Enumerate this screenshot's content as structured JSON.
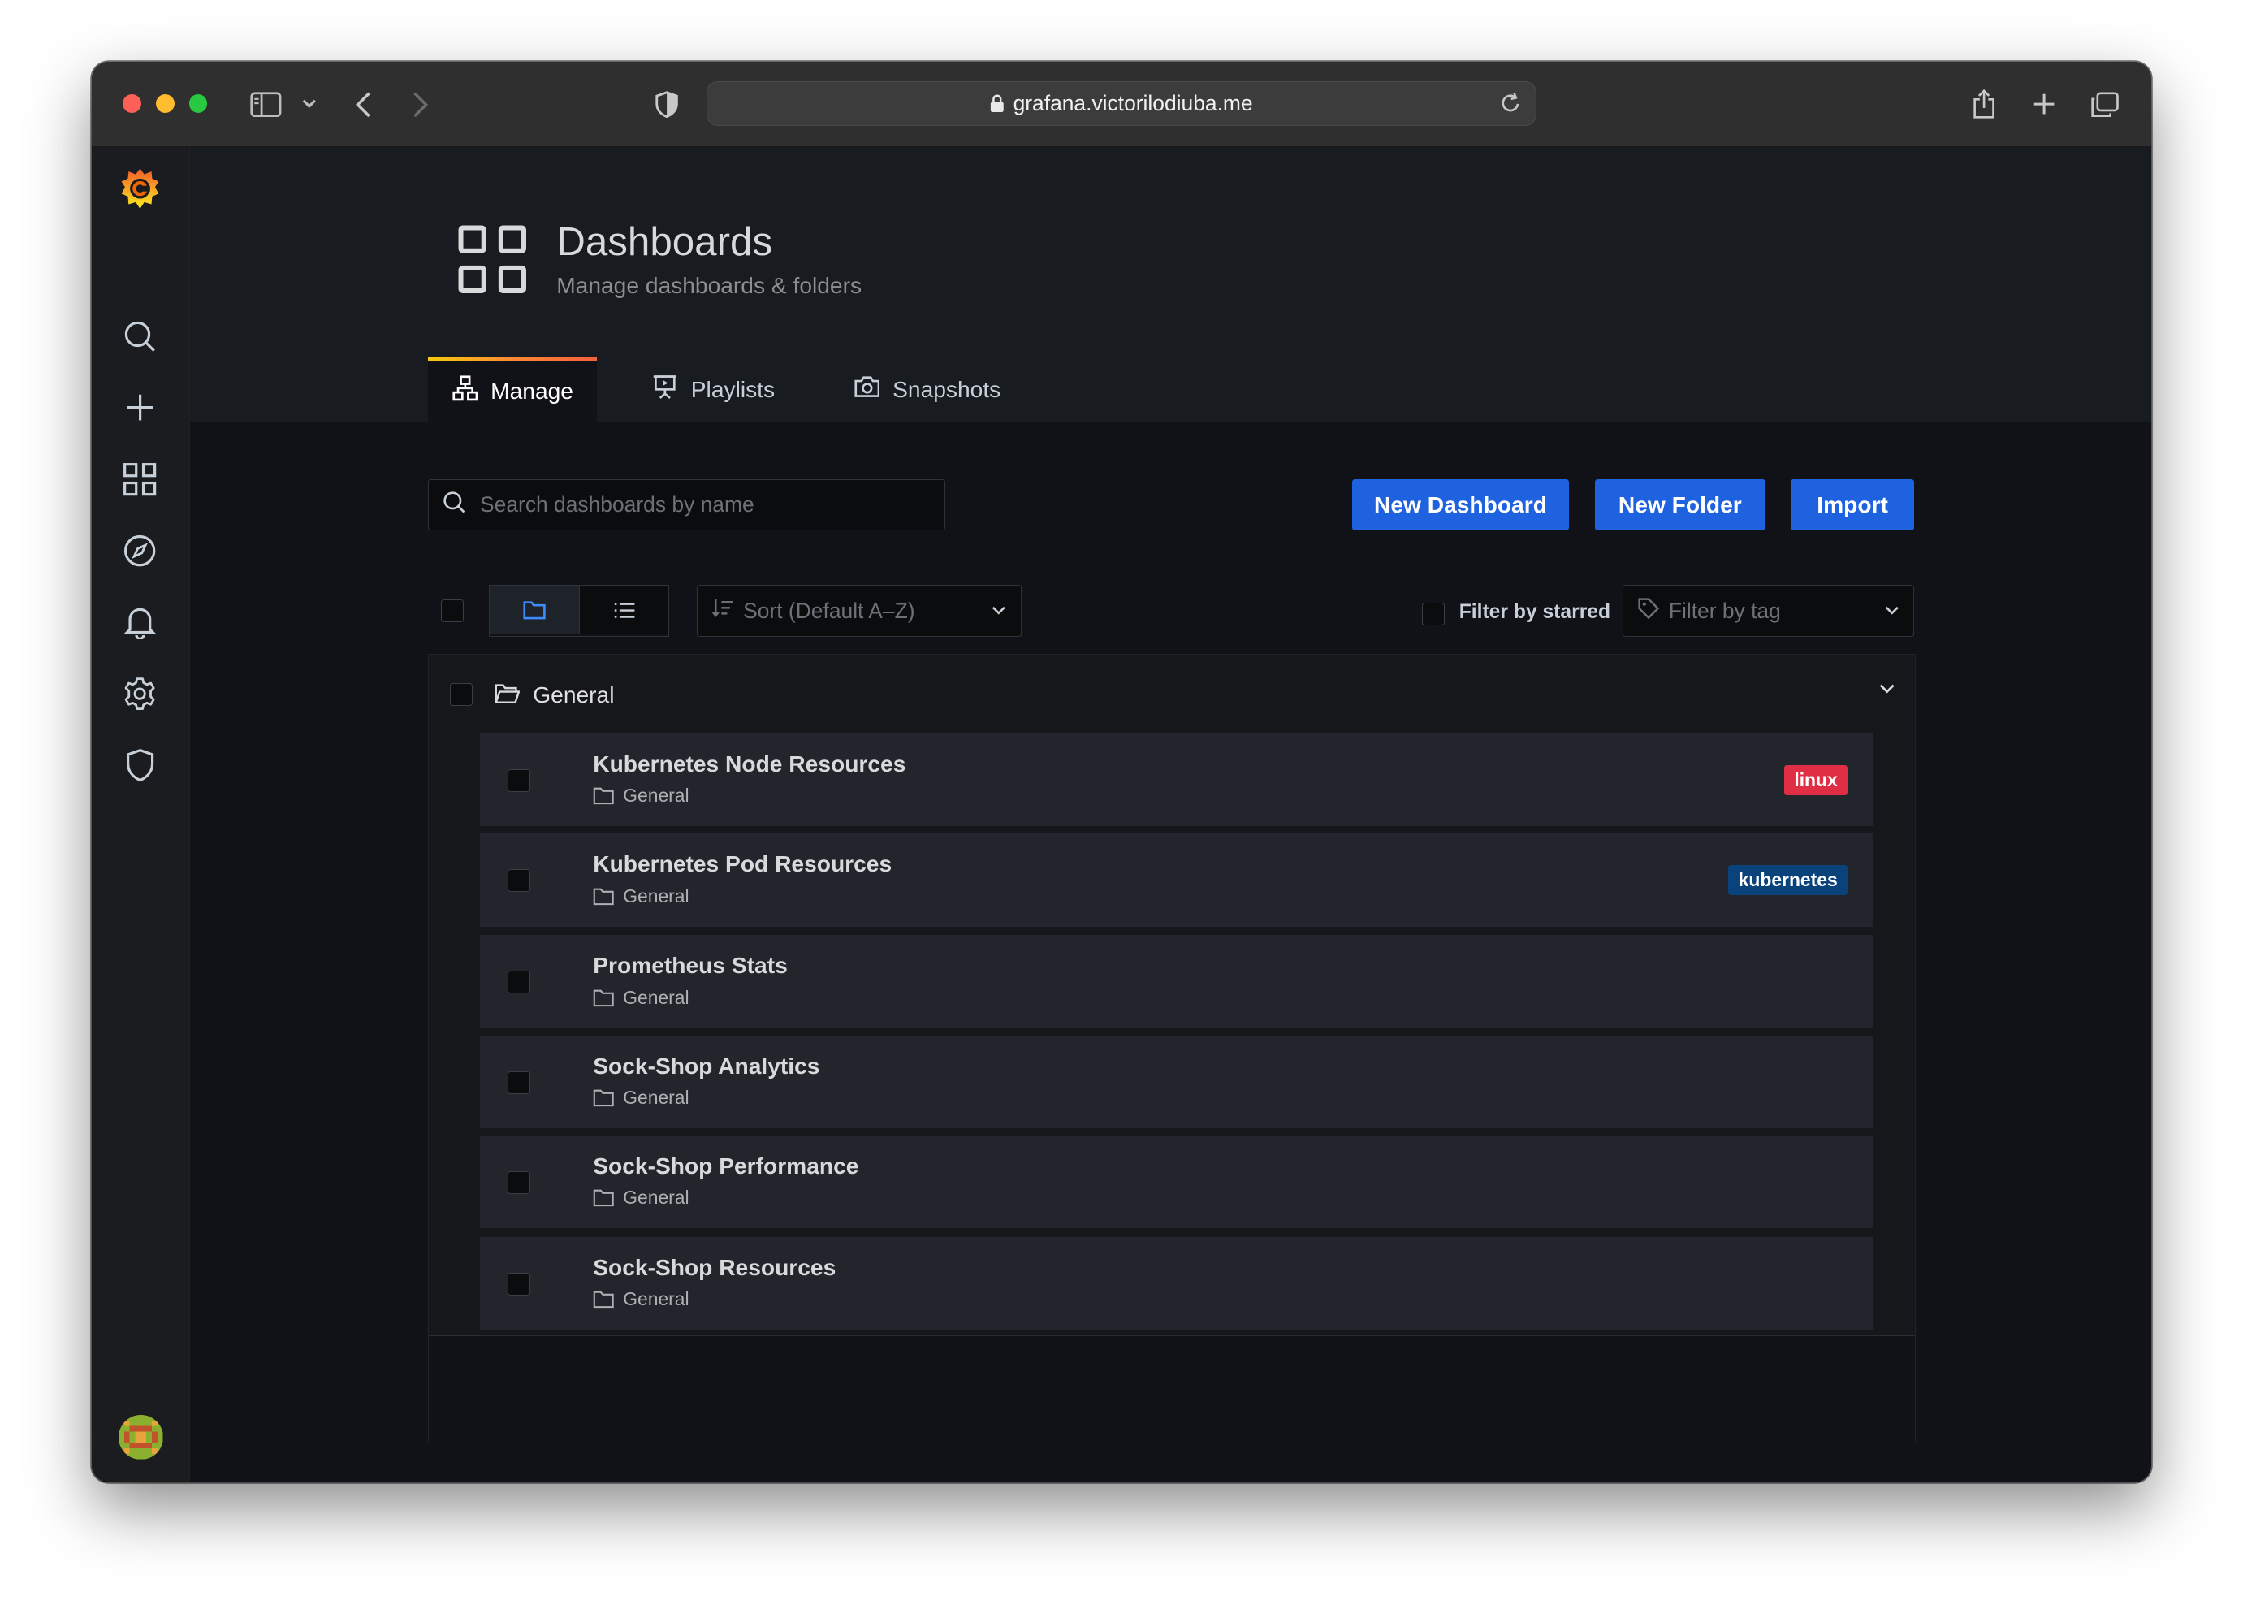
{
  "browser": {
    "url": "grafana.victorilodiuba.me"
  },
  "header": {
    "title": "Dashboards",
    "subtitle": "Manage dashboards & folders"
  },
  "tabs": [
    {
      "label": "Manage",
      "active": true
    },
    {
      "label": "Playlists",
      "active": false
    },
    {
      "label": "Snapshots",
      "active": false
    }
  ],
  "search": {
    "placeholder": "Search dashboards by name",
    "value": ""
  },
  "actions": {
    "new_dashboard": "New Dashboard",
    "new_folder": "New Folder",
    "import": "Import"
  },
  "filters": {
    "sort": "Sort (Default A–Z)",
    "starred_label": "Filter by starred",
    "tag_placeholder": "Filter by tag"
  },
  "folder": {
    "name": "General",
    "items": [
      {
        "title": "Kubernetes Node Resources",
        "folder": "General",
        "tag": "linux"
      },
      {
        "title": "Kubernetes Pod Resources",
        "folder": "General",
        "tag": "kubernetes"
      },
      {
        "title": "Prometheus Stats",
        "folder": "General"
      },
      {
        "title": "Sock-Shop Analytics",
        "folder": "General"
      },
      {
        "title": "Sock-Shop Performance",
        "folder": "General"
      },
      {
        "title": "Sock-Shop Resources",
        "folder": "General"
      }
    ]
  },
  "colors": {
    "primary_button": "#1f62e0",
    "tag_linux": "#e02f44",
    "tag_kubernetes": "#0a437c",
    "logo_orange": "#f46800"
  }
}
